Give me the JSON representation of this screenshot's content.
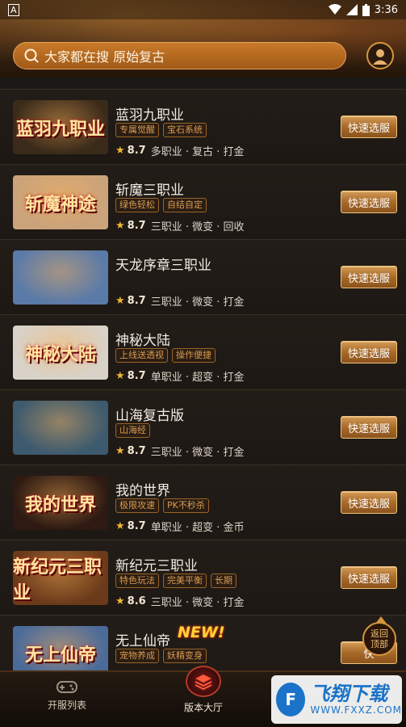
{
  "statusbar": {
    "left_icon": "A",
    "time": "3:36"
  },
  "search": {
    "placeholder": "大家都在搜 原始复古"
  },
  "games": [
    {
      "title": "蓝羽九职业",
      "tags": [
        "专属觉醒",
        "宝石系统"
      ],
      "score": "8.7",
      "info": "多职业 · 复古 · 打金",
      "button": "快速选服",
      "thumb_text": "蓝羽九职业",
      "thumb_color": "#3a2a1a"
    },
    {
      "title": "斩魔三职业",
      "tags": [
        "绿色轻松",
        "自结自定"
      ],
      "score": "8.7",
      "info": "三职业 · 微变 · 回收",
      "button": "快速选服",
      "thumb_text": "斩魔神途",
      "thumb_color": "#caa37a"
    },
    {
      "title": "天龙序章三职业",
      "tags": [],
      "score": "8.7",
      "info": "三职业 · 微变 · 打金",
      "button": "快速选服",
      "thumb_text": "",
      "thumb_color": "#5a7aa8"
    },
    {
      "title": "神秘大陆",
      "tags": [
        "上线送透视",
        "操作便捷"
      ],
      "score": "8.7",
      "info": "单职业 · 超变 · 打金",
      "button": "快速选服",
      "thumb_text": "神秘大陆",
      "thumb_color": "#d8d2c8"
    },
    {
      "title": "山海复古版",
      "tags": [
        "山海经"
      ],
      "score": "8.7",
      "info": "三职业 · 微变 · 打金",
      "button": "快速选服",
      "thumb_text": "",
      "thumb_color": "#3d5a6e"
    },
    {
      "title": "我的世界",
      "tags": [
        "极限攻速",
        "PK不秒杀"
      ],
      "score": "8.7",
      "info": "单职业 · 超变 · 金币",
      "button": "快速选服",
      "thumb_text": "我的世界",
      "thumb_color": "#2e1a12"
    },
    {
      "title": "新纪元三职业",
      "tags": [
        "特色玩法",
        "完美平衡",
        "长期"
      ],
      "score": "8.6",
      "info": "三职业 · 微变 · 打金",
      "button": "快速选服",
      "thumb_text": "新纪元三职业",
      "thumb_color": "#6a3a1a"
    },
    {
      "title": "无上仙帝",
      "tags": [
        "宠物养成",
        "妖精变身"
      ],
      "score": "",
      "info": "",
      "button": "快",
      "thumb_text": "无上仙帝",
      "thumb_color": "#4a6a9a",
      "badge": "NEW!"
    }
  ],
  "back_to_top": "返回\n顶部",
  "nav": {
    "left": "开服列表",
    "center": "版本大厅"
  },
  "watermark": {
    "title": "飞翔下载",
    "url": "WWW.FXXZ.COM"
  }
}
